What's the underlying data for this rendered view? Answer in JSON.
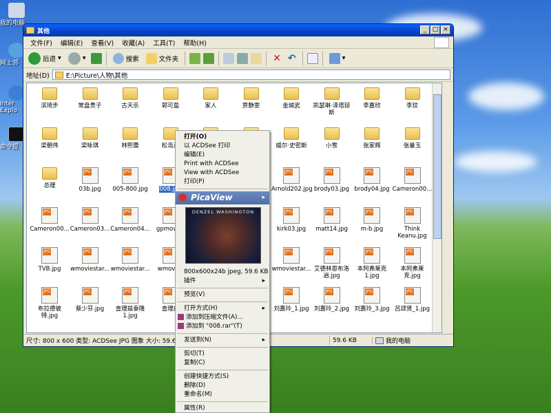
{
  "desktop": {
    "icons": [
      {
        "label": "我的电脑"
      },
      {
        "label": "网上邻"
      },
      {
        "label": "Inter Explo"
      },
      {
        "label": "命令提"
      }
    ]
  },
  "window": {
    "title": "其他",
    "buttons": {
      "min": "_",
      "max": "□",
      "close": "×"
    },
    "menu": [
      "文件(F)",
      "编辑(E)",
      "查看(V)",
      "收藏(A)",
      "工具(T)",
      "帮助(H)"
    ],
    "toolbar": {
      "back": "后退",
      "search": "搜索",
      "folders": "文件夹"
    },
    "address": {
      "label": "地址(D)",
      "value": "E:\\Picture\\人物\\其他"
    },
    "status": {
      "info": "尺寸: 800 x 600 类型: ACDSee JPG 图象 大小: 59.6 KB",
      "size": "59.6 KB",
      "location": "我的电脑"
    }
  },
  "files": [
    {
      "name": "滨琦步",
      "type": "folder"
    },
    {
      "name": "常盘贵子",
      "type": "folder"
    },
    {
      "name": "古天乐",
      "type": "folder"
    },
    {
      "name": "郭可盈",
      "type": "folder"
    },
    {
      "name": "家人",
      "type": "folder"
    },
    {
      "name": "贾静雯",
      "type": "folder"
    },
    {
      "name": "金城武",
      "type": "folder"
    },
    {
      "name": "凯瑟琳·泽塔琼斯",
      "type": "folder"
    },
    {
      "name": "李嘉欣",
      "type": "folder"
    },
    {
      "name": "李玟",
      "type": "folder"
    },
    {
      "name": "梁朝伟",
      "type": "folder"
    },
    {
      "name": "梁咏琪",
      "type": "folder"
    },
    {
      "name": "林熙蕾",
      "type": "folder"
    },
    {
      "name": "松岛菜",
      "type": "folder"
    },
    {
      "name": "",
      "type": "folder"
    },
    {
      "name": "",
      "type": "folder"
    },
    {
      "name": "威尔·史密斯",
      "type": "folder"
    },
    {
      "name": "小雪",
      "type": "folder"
    },
    {
      "name": "张家辉",
      "type": "folder"
    },
    {
      "name": "张曼玉",
      "type": "folder"
    },
    {
      "name": "总理",
      "type": "folder"
    },
    {
      "name": "03b.jpg",
      "type": "jpg"
    },
    {
      "name": "005-800.jpg",
      "type": "jpg"
    },
    {
      "name": "008.jpg",
      "type": "jpg",
      "selected": true
    },
    {
      "name": "",
      "type": "jpg"
    },
    {
      "name": "",
      "type": "jpg"
    },
    {
      "name": "Arnold202.jpg",
      "type": "jpg"
    },
    {
      "name": "brody03.jpg",
      "type": "jpg"
    },
    {
      "name": "brody04.jpg",
      "type": "jpg"
    },
    {
      "name": "Cameron00...",
      "type": "jpg"
    },
    {
      "name": "Cameron00...",
      "type": "jpg"
    },
    {
      "name": "Cameron03...",
      "type": "jpg"
    },
    {
      "name": "Cameron04...",
      "type": "jpg"
    },
    {
      "name": "gpmovie_",
      "type": "jpg"
    },
    {
      "name": "",
      "type": "jpg"
    },
    {
      "name": "",
      "type": "jpg"
    },
    {
      "name": "kirk03.jpg",
      "type": "jpg"
    },
    {
      "name": "matt14.jpg",
      "type": "jpg"
    },
    {
      "name": "m-b.jpg",
      "type": "jpg"
    },
    {
      "name": "Think Keanu.jpg",
      "type": "jpg"
    },
    {
      "name": "TVB.jpg",
      "type": "jpg"
    },
    {
      "name": "wmoviestar...",
      "type": "jpg"
    },
    {
      "name": "wmoviestar...",
      "type": "jpg"
    },
    {
      "name": "wmovies",
      "type": "jpg"
    },
    {
      "name": "",
      "type": "jpg"
    },
    {
      "name": "",
      "type": "jpg"
    },
    {
      "name": "wmoviestar...",
      "type": "jpg"
    },
    {
      "name": "艾德林恩布洛逍.jpg",
      "type": "jpg"
    },
    {
      "name": "本阿弗莱克1.jpg",
      "type": "jpg"
    },
    {
      "name": "本阿弗莱克.jpg",
      "type": "jpg"
    },
    {
      "name": "布拉德彼特.jpg",
      "type": "jpg"
    },
    {
      "name": "蔡少芬.jpg",
      "type": "jpg"
    },
    {
      "name": "查理兹泰隆1.jpg",
      "type": "jpg"
    },
    {
      "name": "查理兹",
      "type": "jpg"
    },
    {
      "name": "",
      "type": "jpg"
    },
    {
      "name": "",
      "type": "jpg"
    },
    {
      "name": "刘嘉玲_1.jpg",
      "type": "jpg"
    },
    {
      "name": "刘嘉玲_2.jpg",
      "type": "jpg"
    },
    {
      "name": "刘嘉玲_3.jpg",
      "type": "jpg"
    },
    {
      "name": "吕颂贤_1.jpg",
      "type": "jpg"
    }
  ],
  "context_menu": {
    "items_a": [
      "打开(O)",
      "以 ACDSee 打印",
      "编辑(E)",
      "Print with ACDSee",
      "View with ACDSee",
      "打印(P)"
    ],
    "picasa": "PicaView",
    "thumb_caption": "DENZEL WASHINGTON",
    "img_info": "800x600x24b jpeg, 59.6 KB",
    "plugins": "插件",
    "preview": "预览(V)",
    "open_with": "打开方式(H)",
    "add_archive": "添加到压缩文件(A)...",
    "add_rar": "添加到 \"008.rar\"(T)",
    "send_to": "发送到(N)",
    "cut": "剪切(T)",
    "copy": "复制(C)",
    "shortcut": "创建快捷方式(S)",
    "delete": "删除(D)",
    "rename": "重命名(M)",
    "properties": "属性(R)"
  }
}
